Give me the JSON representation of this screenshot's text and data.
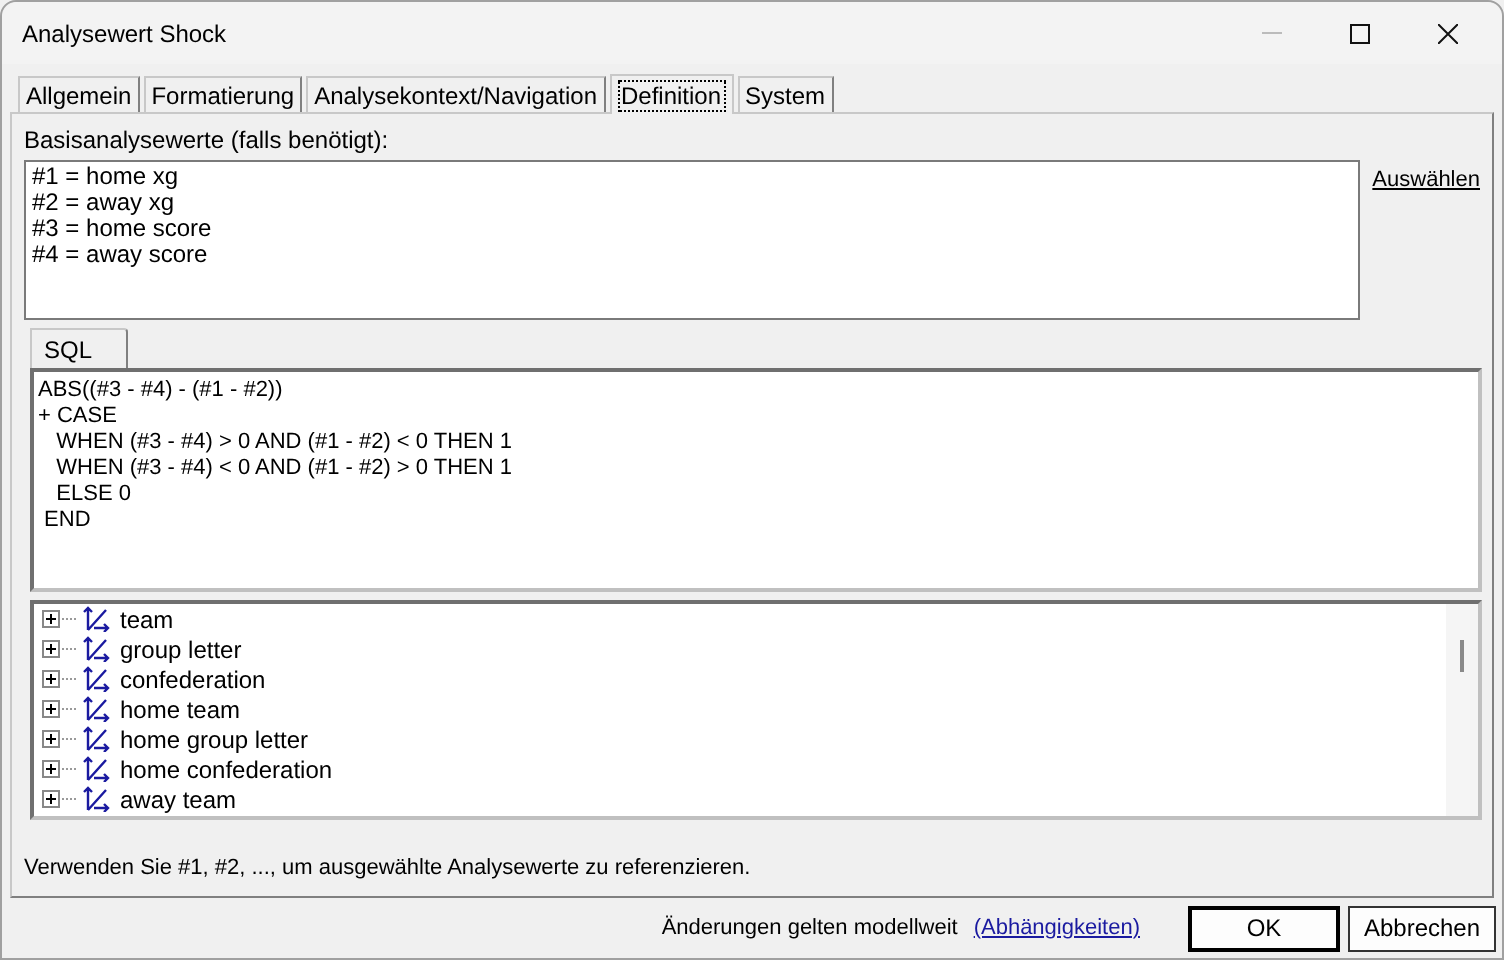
{
  "window": {
    "title": "Analysewert Shock"
  },
  "tabs": [
    {
      "label": "Allgemein",
      "selected": false
    },
    {
      "label": "Formatierung",
      "selected": false
    },
    {
      "label": "Analysekontext/Navigation",
      "selected": false
    },
    {
      "label": "Definition",
      "selected": true
    },
    {
      "label": "System",
      "selected": false
    }
  ],
  "base_values": {
    "label": "Basisanalysewerte (falls benötigt):",
    "lines": [
      "#1 = home xg",
      "#2 = away xg",
      "#3 = home score",
      "#4 = away score"
    ],
    "link": "Auswählen"
  },
  "editor_tabs": [
    {
      "label": "SQL",
      "selected": true
    }
  ],
  "sql": [
    "ABS((#3 - #4) - (#1 - #2))",
    "+ CASE",
    "   WHEN (#3 - #4) > 0 AND (#1 - #2) < 0 THEN 1",
    "   WHEN (#3 - #4) < 0 AND (#1 - #2) > 0 THEN 1",
    "   ELSE 0",
    " END"
  ],
  "tree": [
    {
      "label": "team",
      "expanded": false
    },
    {
      "label": "group letter",
      "expanded": false
    },
    {
      "label": "confederation",
      "expanded": false
    },
    {
      "label": "home team",
      "expanded": false
    },
    {
      "label": "home group letter",
      "expanded": false
    },
    {
      "label": "home confederation",
      "expanded": false
    },
    {
      "label": "away team",
      "expanded": false
    }
  ],
  "hint": "Verwenden Sie #1, #2, ..., um ausgewählte Analysewerte zu referenzieren.",
  "footer": {
    "note": "Änderungen gelten modellweit",
    "link": "(Abhängigkeiten)",
    "buttons": [
      {
        "label": "OK",
        "default": true
      },
      {
        "label": "Abbrechen",
        "default": false
      }
    ]
  }
}
